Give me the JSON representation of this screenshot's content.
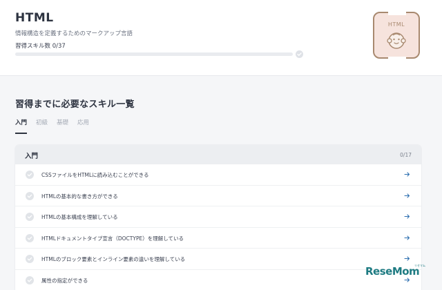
{
  "header": {
    "title": "HTML",
    "subtitle": "情報構造を定義するためのマークアップ言語",
    "skill_count": "習得スキル数 0/37",
    "progress": 0,
    "badge_label": "HTML"
  },
  "section": {
    "title": "習得までに必要なスキル一覧"
  },
  "tabs": [
    {
      "label": "入門",
      "active": true
    },
    {
      "label": "初級",
      "active": false
    },
    {
      "label": "基礎",
      "active": false
    },
    {
      "label": "応用",
      "active": false
    }
  ],
  "panel": {
    "title": "入門",
    "count": "0/17",
    "items": [
      {
        "label": "CSSファイルをHTMLに読み込むことができる"
      },
      {
        "label": "HTMLの基本的な書き方ができる"
      },
      {
        "label": "HTMLの基本構成を理解している"
      },
      {
        "label": "HTMLドキュメントタイプ宣言（DOCTYPE）を理解している"
      },
      {
        "label": "HTMLのブロック要素とインライン要素の違いを理解している"
      },
      {
        "label": "属性の指定ができる"
      }
    ]
  },
  "watermark": {
    "text": "ReseMom",
    "sub": "リセマム"
  },
  "colors": {
    "accent": "#2d3340",
    "badge_bg": "#f6e3dd",
    "badge_border": "#a8896f",
    "arrow": "#2d6fb0"
  }
}
